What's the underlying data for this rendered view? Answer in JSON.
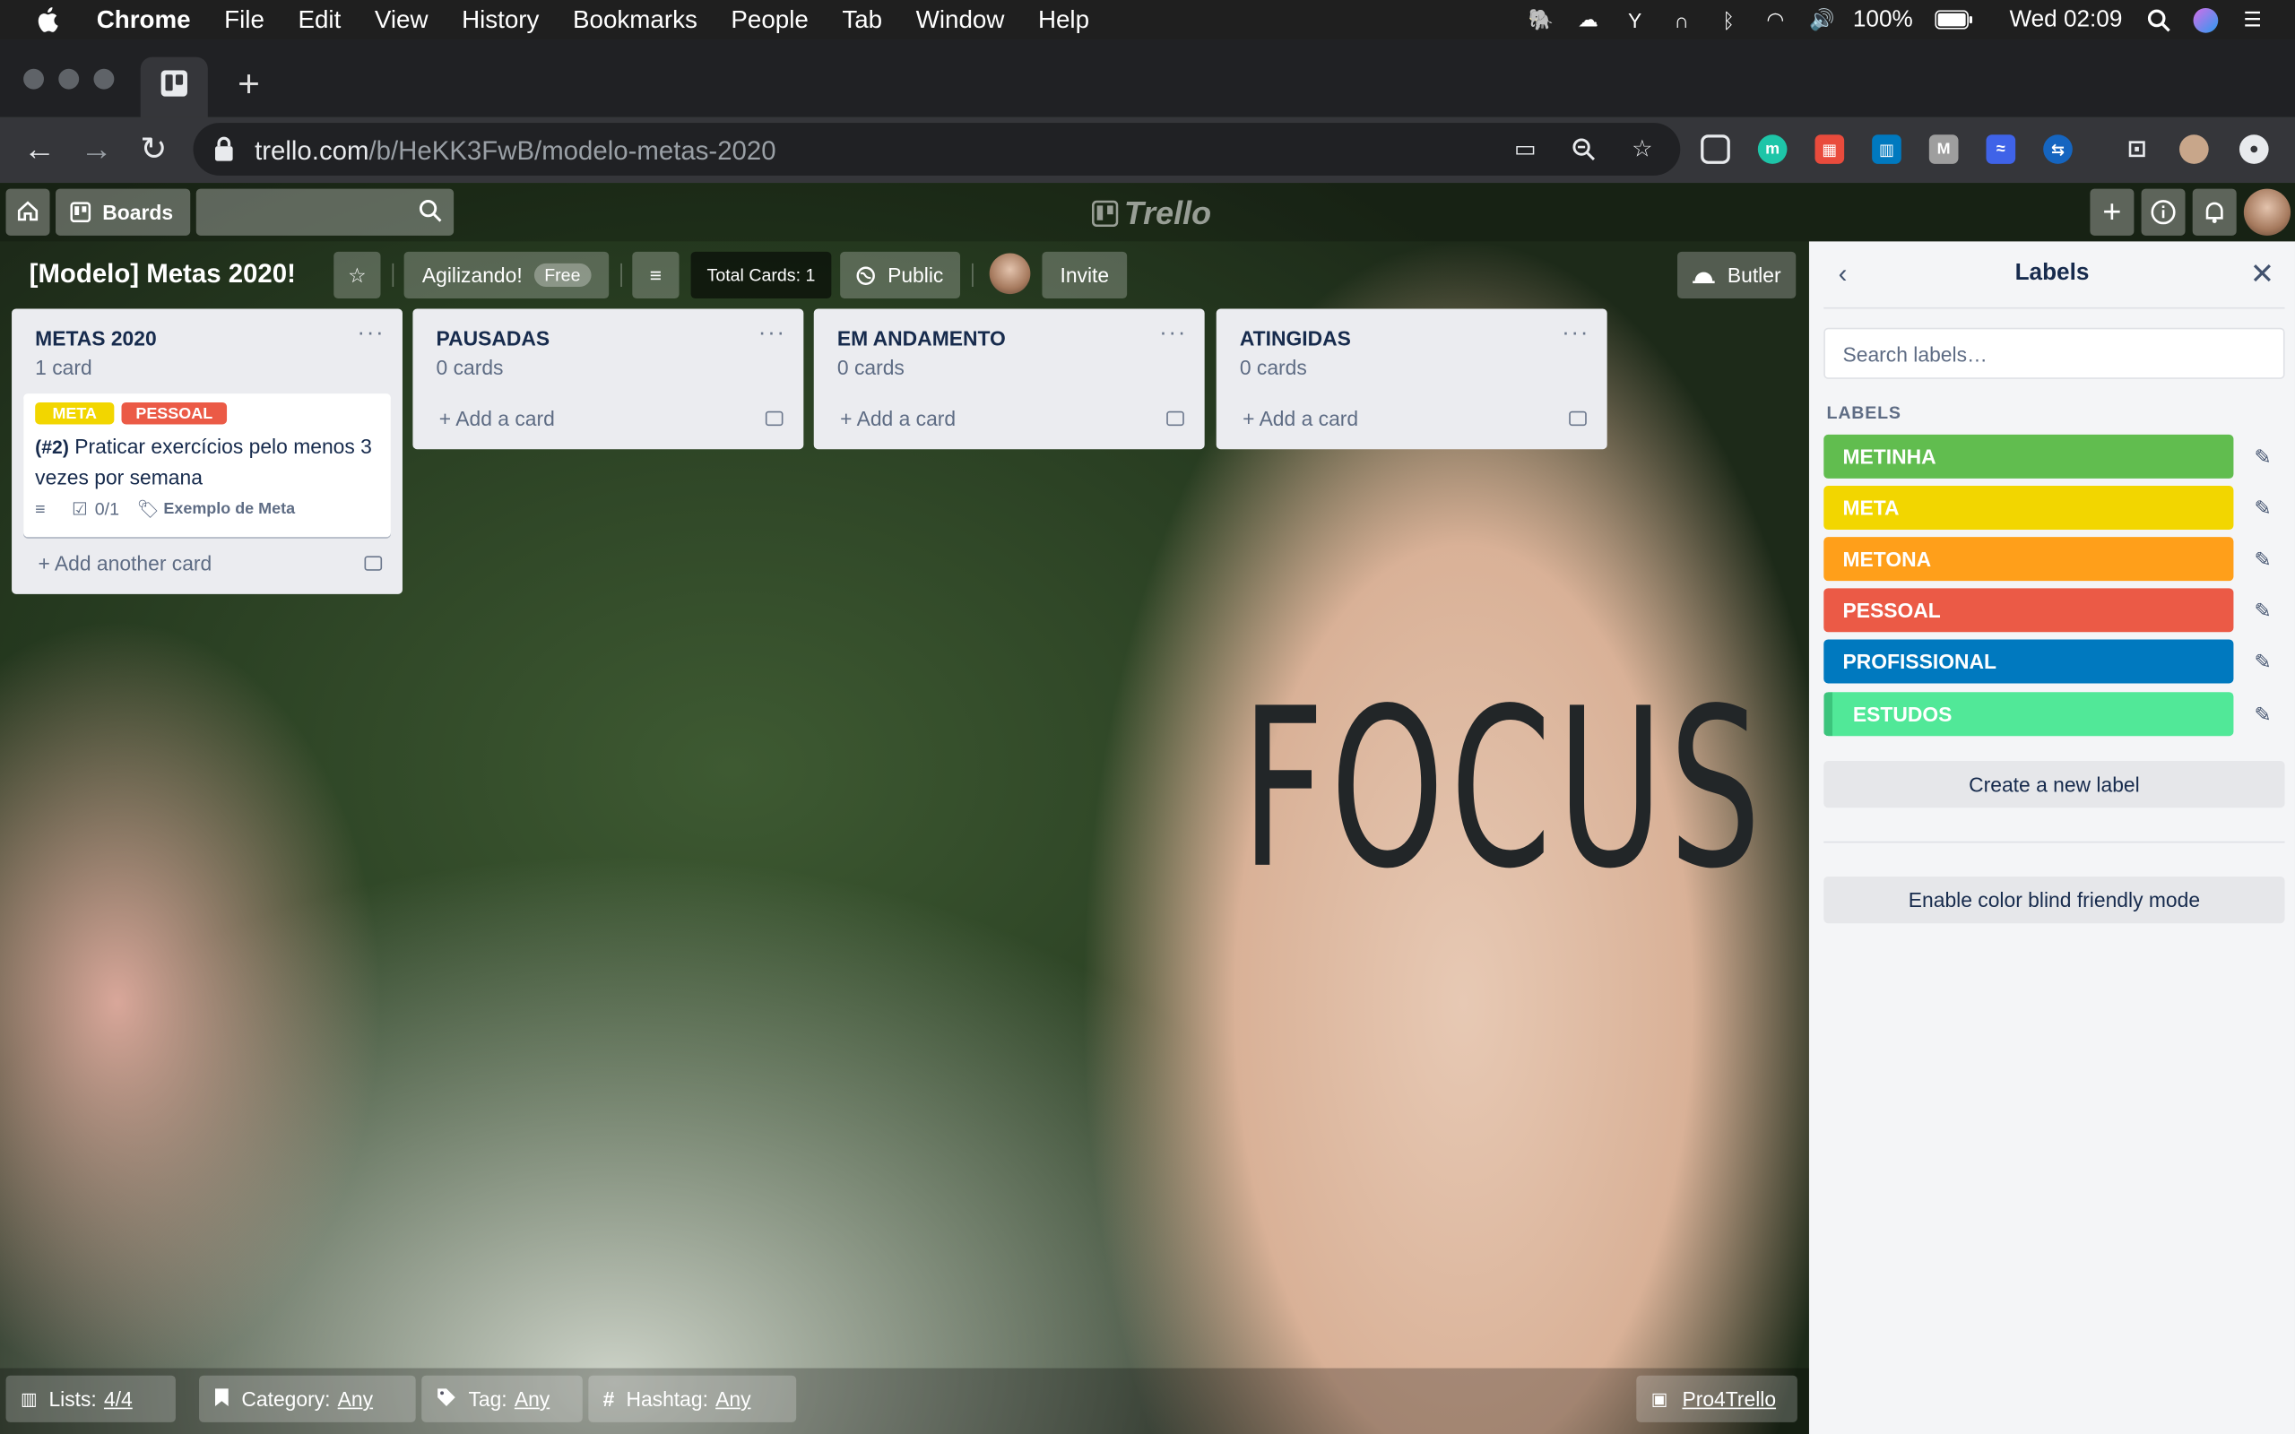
{
  "menubar": {
    "app": "Chrome",
    "items": [
      "File",
      "Edit",
      "View",
      "History",
      "Bookmarks",
      "People",
      "Tab",
      "Window",
      "Help"
    ],
    "battery": "100%",
    "clock": "Wed 02:09"
  },
  "browser": {
    "url_host": "trello.com",
    "url_path": "/b/HeKK3FwB/modelo-metas-2020"
  },
  "trello_nav": {
    "boards_label": "Boards",
    "logo": "Trello"
  },
  "board": {
    "title": "[Modelo] Metas 2020!",
    "team_button": "Agilizando!",
    "team_badge": "Free",
    "total_cards": "Total Cards: 1",
    "visibility": "Public",
    "invite": "Invite",
    "butler": "Butler",
    "background_text": "FOCUS"
  },
  "lists": [
    {
      "name": "METAS 2020",
      "count": "1 card",
      "add_label": "Add another card",
      "card": {
        "labels": [
          {
            "text": "META",
            "color": "#f2d600"
          },
          {
            "text": "PESSOAL",
            "color": "#eb5a46"
          }
        ],
        "prefix": "(#2)",
        "title": " Praticar exercícios pelo menos 3 vezes por semana",
        "checklist": "0/1",
        "tag": "Exemplo de Meta"
      }
    },
    {
      "name": "PAUSADAS",
      "count": "0 cards",
      "add_label": "Add a card"
    },
    {
      "name": "EM ANDAMENTO",
      "count": "0 cards",
      "add_label": "Add a card"
    },
    {
      "name": "ATINGIDAS",
      "count": "0 cards",
      "add_label": "Add a card"
    }
  ],
  "labels_panel": {
    "title": "Labels",
    "search_placeholder": "Search labels…",
    "heading": "LABELS",
    "labels": [
      {
        "name": "METINHA",
        "color": "#61bd4f"
      },
      {
        "name": "META",
        "color": "#f2d600"
      },
      {
        "name": "METONA",
        "color": "#ff9f1a"
      },
      {
        "name": "PESSOAL",
        "color": "#eb5a46"
      },
      {
        "name": "PROFISSIONAL",
        "color": "#0079bf"
      },
      {
        "name": "ESTUDOS",
        "color": "#51e898"
      }
    ],
    "create_button": "Create a new label",
    "colorblind_button": "Enable color blind friendly mode"
  },
  "footer": {
    "lists_label": "Lists:",
    "lists_value": "4/4",
    "category_label": "Category:",
    "category_value": "Any",
    "tag_label": "Tag:",
    "tag_value": "Any",
    "hashtag_label": "Hashtag:",
    "hashtag_value": "Any",
    "pro4trello": "Pro4Trello"
  }
}
